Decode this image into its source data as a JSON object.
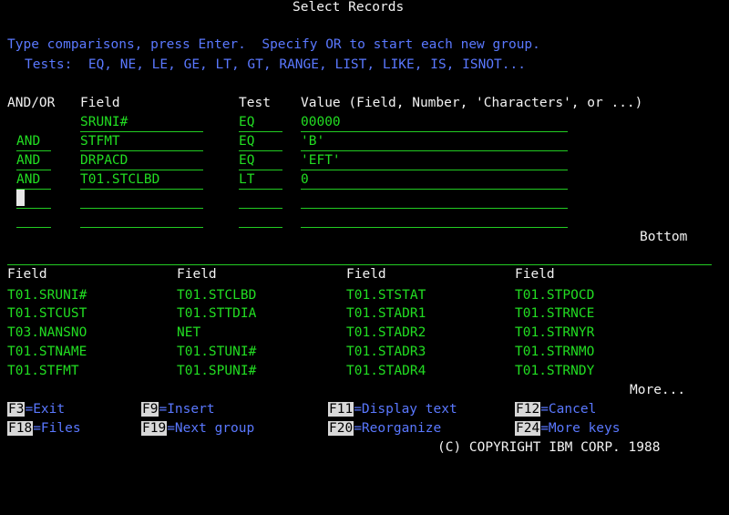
{
  "title": "Select Records",
  "instructions": {
    "line1": "Type comparisons, press Enter.  Specify OR to start each new group.",
    "line2": "Tests:  EQ, NE, LE, GE, LT, GT, RANGE, LIST, LIKE, IS, ISNOT..."
  },
  "headers": {
    "andor": "AND/OR",
    "field": "Field",
    "test": "Test",
    "value": "Value (Field, Number, 'Characters', or ...)"
  },
  "criteria": [
    {
      "andor": "",
      "field": "SRUNI#",
      "test": "EQ",
      "value": "00000"
    },
    {
      "andor": "AND",
      "field": "STFMT",
      "test": "EQ",
      "value": "'B'"
    },
    {
      "andor": "AND",
      "field": "DRPACD",
      "test": "EQ",
      "value": "'EFT'"
    },
    {
      "andor": "AND",
      "field": "T01.STCLBD",
      "test": "LT",
      "value": "0"
    },
    {
      "andor": "",
      "field": "",
      "test": "",
      "value": ""
    },
    {
      "andor": "",
      "field": "",
      "test": "",
      "value": ""
    }
  ],
  "bottom_label": "Bottom",
  "field_list": {
    "headers": [
      "Field",
      "Field",
      "Field",
      "Field"
    ],
    "rows": [
      [
        "T01.SRUNI#",
        "T01.STCLBD",
        "T01.STSTAT",
        "T01.STPOCD"
      ],
      [
        "T01.STCUST",
        "T01.STTDIA",
        "T01.STADR1",
        "T01.STRNCE"
      ],
      [
        "T03.NANSNO",
        "NET",
        "T01.STADR2",
        "T01.STRNYR"
      ],
      [
        "T01.STNAME",
        "T01.STUNI#",
        "T01.STADR3",
        "T01.STRNMO"
      ],
      [
        "T01.STFMT",
        "T01.SPUNI#",
        "T01.STADR4",
        "T01.STRNDY"
      ]
    ],
    "more_label": "More..."
  },
  "function_keys": [
    {
      "key": "F3",
      "label": "=Exit"
    },
    {
      "key": "F9",
      "label": "=Insert"
    },
    {
      "key": "F11",
      "label": "=Display text"
    },
    {
      "key": "F12",
      "label": "=Cancel"
    },
    {
      "key": "F18",
      "label": "=Files"
    },
    {
      "key": "F19",
      "label": "=Next group"
    },
    {
      "key": "F20",
      "label": "=Reorganize"
    },
    {
      "key": "F24",
      "label": "=More keys"
    }
  ],
  "copyright": "(C) COPYRIGHT IBM CORP. 1988",
  "colors": {
    "background": "#000000",
    "text_white": "#f2f2f2",
    "text_blue": "#5a78ff",
    "text_green": "#22dd22"
  }
}
